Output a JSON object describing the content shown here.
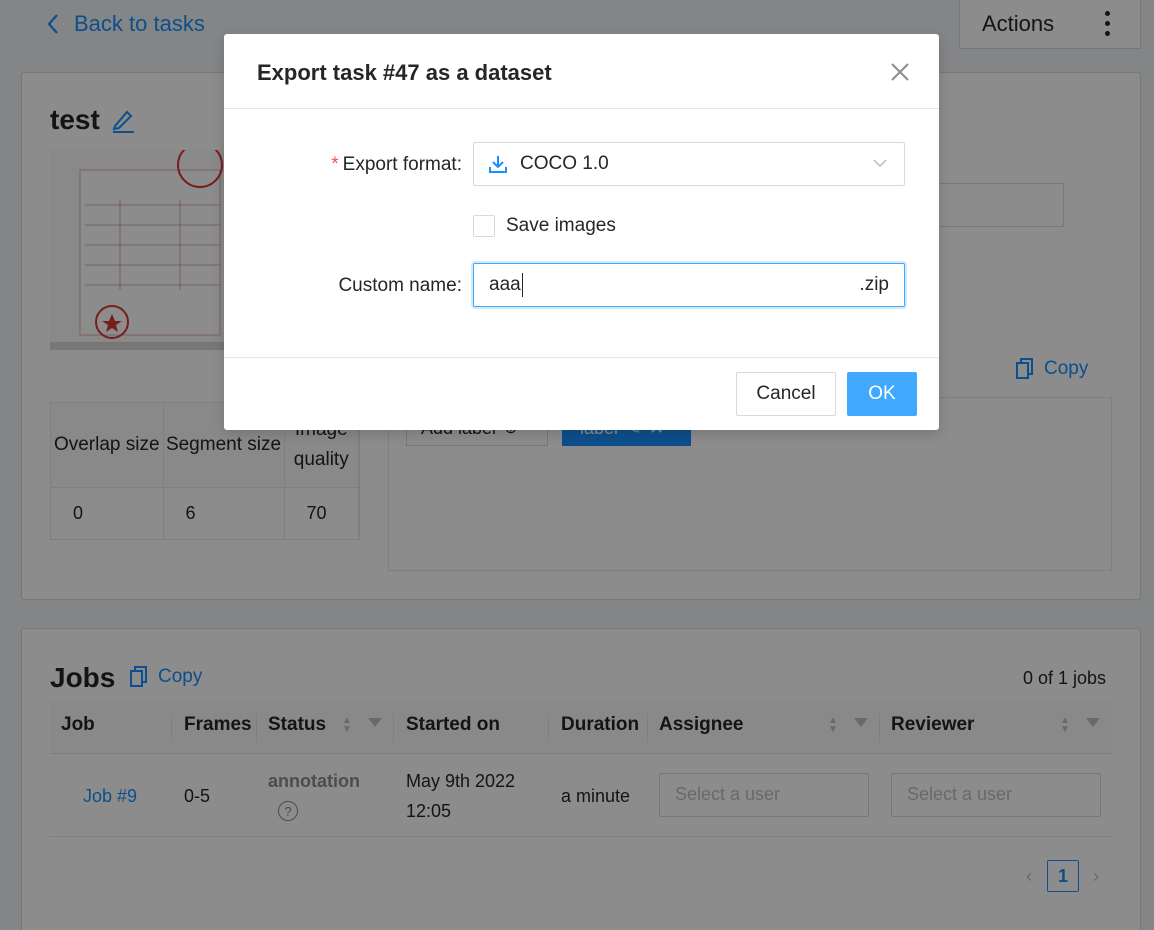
{
  "nav": {
    "back_label": "Back to tasks",
    "actions_label": "Actions"
  },
  "task": {
    "title": "test",
    "params_headers": [
      "Overlap size",
      "Segment size",
      "Image quality"
    ],
    "params_values": [
      "0",
      "6",
      "70"
    ],
    "copy_label": "Copy",
    "add_label": "Add label",
    "label_tag": "label"
  },
  "jobs": {
    "title": "Jobs",
    "copy_label": "Copy",
    "count": "0 of 1 jobs",
    "columns": [
      "Job",
      "Frames",
      "Status",
      "Started on",
      "Duration",
      "Assignee",
      "Reviewer"
    ],
    "rows": [
      {
        "job": "Job #9",
        "frames": "0-5",
        "status": "annotation",
        "started_line1": "May 9th 2022",
        "started_line2": "12:05",
        "duration": "a minute",
        "assignee_placeholder": "Select a user",
        "reviewer_placeholder": "Select a user"
      }
    ],
    "page": "1"
  },
  "modal": {
    "title": "Export task #47 as a dataset",
    "format_label": "Export format",
    "format_value": "COCO 1.0",
    "save_images_label": "Save images",
    "save_images_checked": false,
    "custom_name_label": "Custom name",
    "custom_name_value": "aaa",
    "custom_name_suffix": ".zip",
    "cancel_label": "Cancel",
    "ok_label": "OK"
  },
  "colors": {
    "accent": "#1890ff",
    "required": "#ff4d4f"
  }
}
